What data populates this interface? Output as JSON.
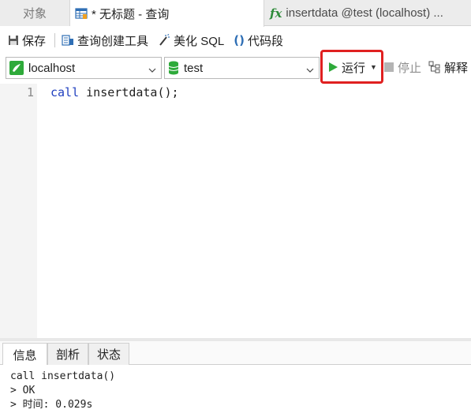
{
  "tabs": {
    "objects": "对象",
    "query": "* 无标题 - 查询",
    "function": "insertdata @test (localhost) ..."
  },
  "toolbar": {
    "save": "保存",
    "query_builder": "查询创建工具",
    "beautify_sql": "美化 SQL",
    "snippet": "代码段"
  },
  "connection": {
    "server": "localhost",
    "database": "test"
  },
  "actions": {
    "run": "运行",
    "stop": "停止",
    "explain": "解释"
  },
  "editor": {
    "line_number": "1",
    "code_keyword": "call",
    "code_rest": " insertdata();"
  },
  "result_tabs": {
    "info": "信息",
    "profile": "剖析",
    "status": "状态"
  },
  "output": {
    "line1": "call insertdata()",
    "line2": "> OK",
    "line3": "> 时间: 0.029s"
  },
  "colors": {
    "run_highlight": "#e02020",
    "run_icon": "#2eaa3a",
    "keyword": "#1f3fbf"
  }
}
